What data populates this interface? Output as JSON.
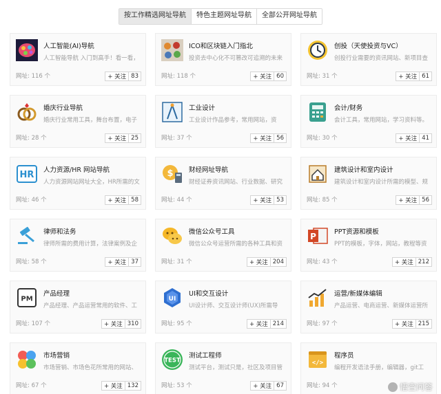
{
  "tabs": [
    {
      "label": "按工作精选网址导航",
      "active": true
    },
    {
      "label": "特色主题网址导航",
      "active": false
    },
    {
      "label": "全部公开网址导航",
      "active": false
    }
  ],
  "follow_label": "+ 关注",
  "cards": [
    {
      "title": "人工智能(AI)导航",
      "desc": "人工智能导航 入门到高手！看一看，",
      "count": "网址: 116 个",
      "follows": "83",
      "icon": "brain-icon"
    },
    {
      "title": "ICO和区块链入门指北",
      "desc": "投资去中心化不可篡改可追溯的未来",
      "count": "网址: 118 个",
      "follows": "60",
      "icon": "blockchain-icon"
    },
    {
      "title": "创投（天使投资与VC）",
      "desc": "创投行业需要的资讯网站、新项目查",
      "count": "网址: 31 个",
      "follows": "61",
      "icon": "investment-clock-icon"
    },
    {
      "title": "婚庆行业导航",
      "desc": "婚庆行业常用工具，舞台布置，电子",
      "count": "网址: 28 个",
      "follows": "25",
      "icon": "wedding-rings-icon"
    },
    {
      "title": "工业设计",
      "desc": "工业设计作品参考，常用网站，资",
      "count": "网址: 37 个",
      "follows": "56",
      "icon": "drafting-compass-icon"
    },
    {
      "title": "会计/财务",
      "desc": "会计工具，常用网站，学习资料等。",
      "count": "网址: 30 个",
      "follows": "41",
      "icon": "calculator-icon"
    },
    {
      "title": "人力资源/HR 网站导航",
      "desc": "人力资源网站网址大全，HR所需的文",
      "count": "网址: 46 个",
      "follows": "58",
      "icon": "hr-icon"
    },
    {
      "title": "财经网址导航",
      "desc": "财经证券资讯网站、行业数据、研究",
      "count": "网址: 44 个",
      "follows": "53",
      "icon": "finance-coin-icon"
    },
    {
      "title": "建筑设计和室内设计",
      "desc": "建筑设计和室内设计所需的模型、规",
      "count": "网址: 85 个",
      "follows": "56",
      "icon": "architecture-icon"
    },
    {
      "title": "律师和法务",
      "desc": "律师所需的费用计算，法律案例及企",
      "count": "网址: 58 个",
      "follows": "37",
      "icon": "gavel-icon"
    },
    {
      "title": "微信公众号工具",
      "desc": "微信公众号运营所需的各种工具和资",
      "count": "网址: 31 个",
      "follows": "204",
      "icon": "wechat-chat-icon"
    },
    {
      "title": "PPT资源和模板",
      "desc": "PPT的模板，字体，网站，教程等资",
      "count": "网址: 43 个",
      "follows": "212",
      "icon": "powerpoint-icon"
    },
    {
      "title": "产品经理",
      "desc": "产品经理、产品运营常用的软件、工",
      "count": "网址: 107 个",
      "follows": "310",
      "icon": "pm-icon"
    },
    {
      "title": "UI和交互设计",
      "desc": "UI设计师、交互设计师(UX)所需导",
      "count": "网址: 95 个",
      "follows": "214",
      "icon": "ui-badge-icon"
    },
    {
      "title": "运营/新媒体编辑",
      "desc": "产品运营、电商运营、新媒体运营所",
      "count": "网址: 97 个",
      "follows": "215",
      "icon": "bar-chart-icon"
    },
    {
      "title": "市场营销",
      "desc": "市场营销、市场色花所常用的网站、",
      "count": "网址: 67 个",
      "follows": "132",
      "icon": "clover-icon"
    },
    {
      "title": "测试工程师",
      "desc": "测试平台，测试只是，社区及项目管",
      "count": "网址: 53 个",
      "follows": "67",
      "icon": "test-badge-icon"
    },
    {
      "title": "程序员",
      "desc": "编程开发语法手册，编辑器，git工",
      "count": "网址: 94 个",
      "follows": "",
      "icon": "code-file-icon"
    }
  ],
  "watermark": "悟空问答"
}
